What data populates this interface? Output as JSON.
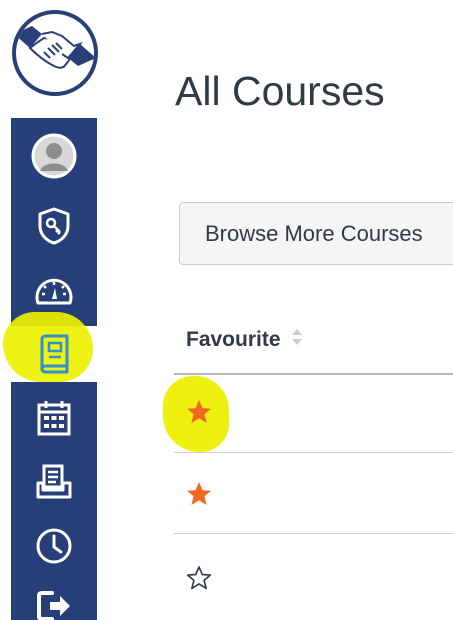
{
  "page": {
    "title": "All Courses"
  },
  "toolbar": {
    "browse_label": "Browse More Courses"
  },
  "table": {
    "columns": [
      "Favourite"
    ],
    "rows": [
      {
        "favourite": true
      },
      {
        "favourite": true
      },
      {
        "favourite": false
      }
    ]
  },
  "nav": {
    "logo_icon": "handshake-icon",
    "items": [
      {
        "icon": "account-avatar-icon",
        "active": false
      },
      {
        "icon": "admin-shield-icon",
        "active": false
      },
      {
        "icon": "dashboard-gauge-icon",
        "active": false
      },
      {
        "icon": "courses-book-icon",
        "active": true
      },
      {
        "icon": "calendar-icon",
        "active": false
      },
      {
        "icon": "inbox-icon",
        "active": false
      },
      {
        "icon": "history-clock-icon",
        "active": false
      },
      {
        "icon": "logout-arrow-icon",
        "active": false
      }
    ]
  },
  "colors": {
    "sidebar": "#263f78",
    "favourite_star": "#f26522",
    "highlight": "#ecf000",
    "text": "#2d3b45"
  }
}
